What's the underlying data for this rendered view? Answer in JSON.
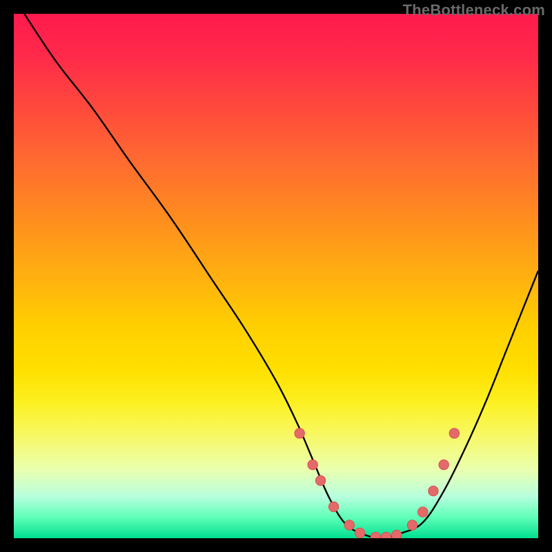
{
  "watermark": "TheBottleneck.com",
  "chart_data": {
    "type": "line",
    "title": "",
    "xlabel": "",
    "ylabel": "",
    "xlim": [
      0,
      100
    ],
    "ylim": [
      0,
      100
    ],
    "grid": false,
    "legend": false,
    "series": [
      {
        "name": "curve",
        "x": [
          2,
          8,
          15,
          22,
          30,
          38,
          44,
          50,
          54,
          57,
          60,
          63,
          66,
          70,
          74,
          78,
          82,
          86,
          90,
          94,
          100
        ],
        "y": [
          100,
          91,
          82,
          72,
          61,
          49,
          40,
          30,
          22,
          15,
          8,
          3,
          1,
          0,
          1,
          3,
          9,
          17,
          26,
          36,
          51
        ]
      }
    ],
    "markers": {
      "name": "dots",
      "x": [
        54.5,
        57,
        58.5,
        61,
        64,
        66,
        69,
        71,
        73,
        76,
        78,
        80,
        82,
        84
      ],
      "y": [
        20,
        14,
        11,
        6,
        2.5,
        1,
        0.2,
        0.2,
        0.6,
        2.5,
        5,
        9,
        14,
        20
      ]
    },
    "colors": {
      "curve": "#000000",
      "marker_fill": "#e46a6a",
      "marker_stroke": "#d84e4e"
    }
  }
}
